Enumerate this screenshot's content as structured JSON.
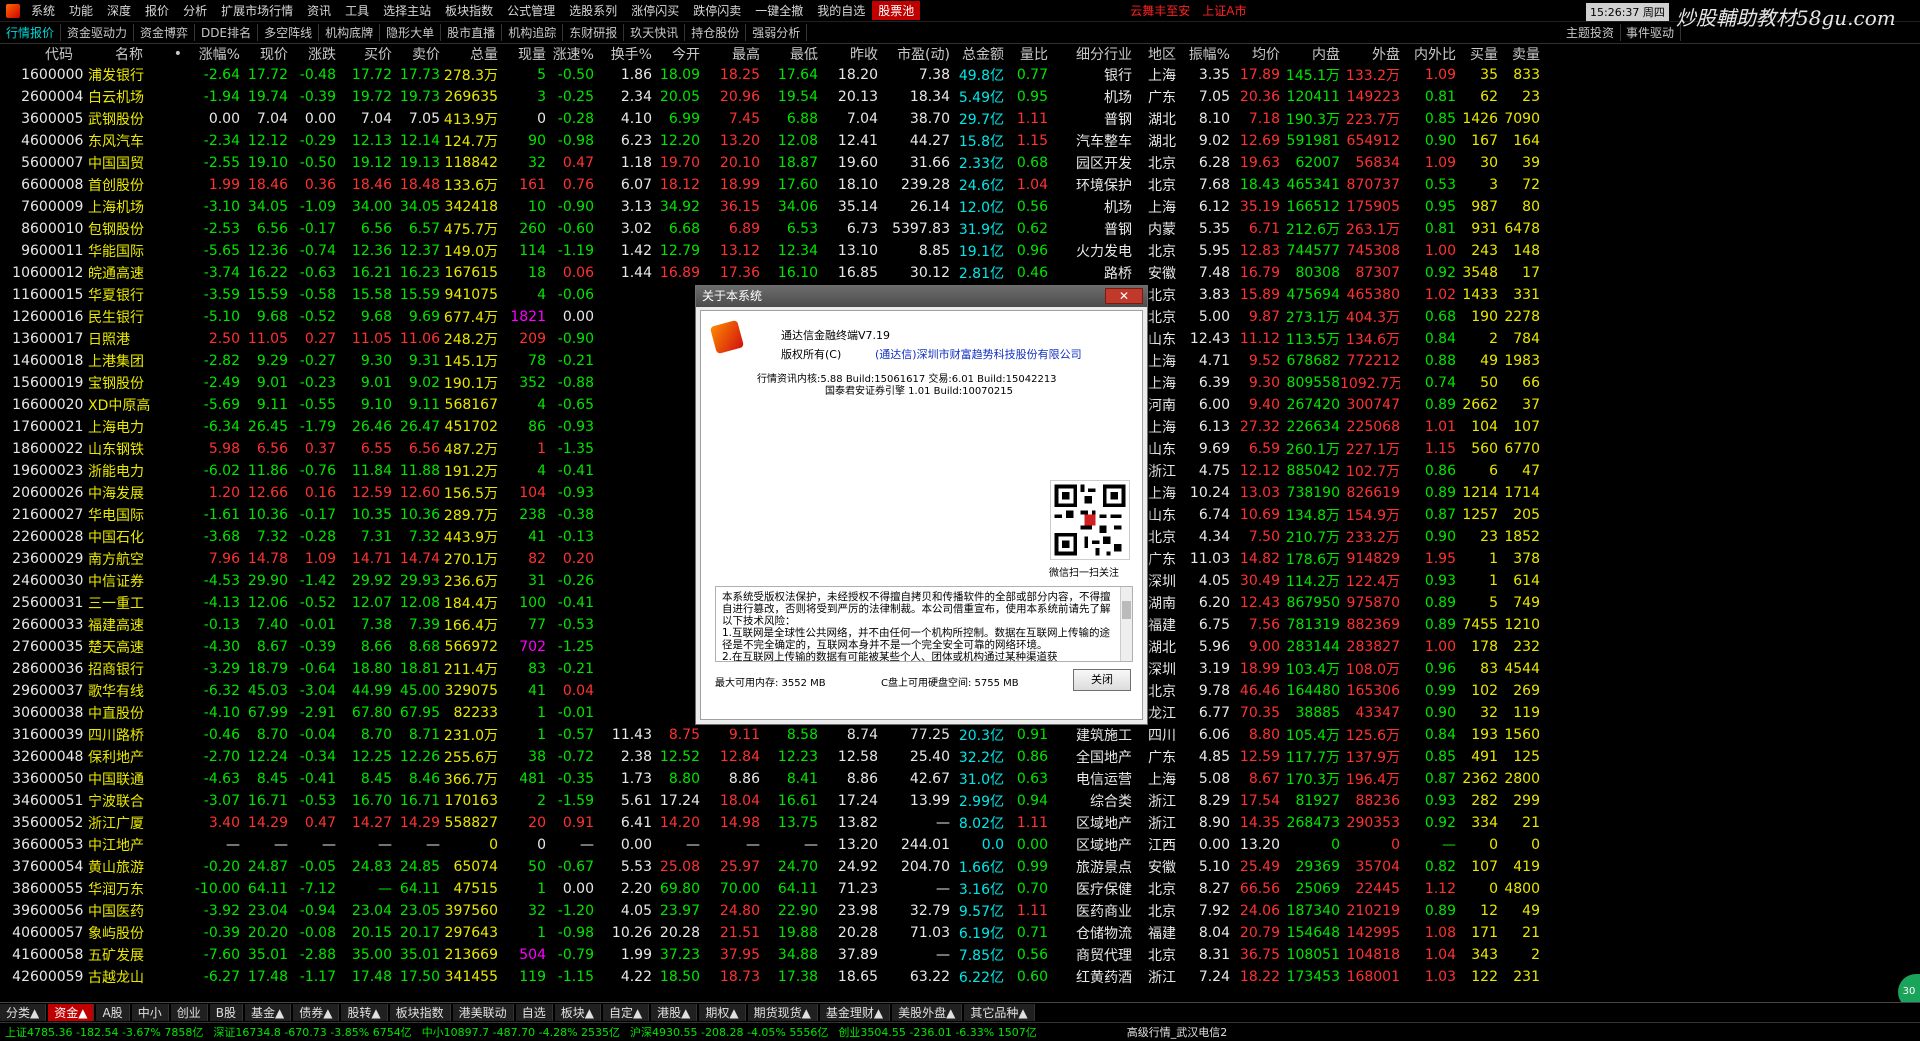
{
  "menubar": {
    "items": [
      "系统",
      "功能",
      "深度",
      "报价",
      "分析",
      "扩展市场行情",
      "资讯",
      "工具",
      "选择主站",
      "板块指数",
      "公式管理",
      "选股系列",
      "涨停闪买",
      "跌停闪卖",
      "一键全撤",
      "我的自选"
    ],
    "highlight": "股票池",
    "notice1": "云舞丰至安",
    "notice2": "上证A市",
    "clock": "15:26:37 周四",
    "brand": "炒股輔助教材58gu.com"
  },
  "toolbar": {
    "items": [
      "行情报价",
      "资金驱动力",
      "资金博弈",
      "DDE排名",
      "多空阵线",
      "机构底牌",
      "隐形大单",
      "股市直播",
      "机构追踪",
      "东财研报",
      "玖天快讯",
      "持仓股份",
      "强弱分析"
    ],
    "right": [
      "主题投资",
      "事件驱动"
    ]
  },
  "columns": [
    "",
    "代码",
    "名称",
    "•",
    "涨幅%",
    "现价",
    "涨跌",
    "买价",
    "卖价",
    "总量",
    "现量",
    "涨速%",
    "换手%",
    "今开",
    "最高",
    "最低",
    "昨收",
    "市盈(动)",
    "总金额",
    "量比",
    "细分行业",
    "地区",
    "振幅%",
    "均价",
    "内盘",
    "外盘",
    "内外比",
    "买量",
    "卖量",
    ""
  ],
  "rows": [
    [
      "1",
      "600000",
      "浦发银行",
      "-2.64",
      "17.72",
      "-0.48",
      "17.72",
      "17.73",
      "278.3万",
      "5",
      "-0.50",
      "1.86",
      "18.09",
      "18.25",
      "17.64",
      "18.20",
      "7.38",
      "49.8亿",
      "0.77",
      "银行",
      "上海",
      "3.35",
      "17.89",
      "145.1万",
      "133.2万",
      "1.09",
      "35",
      "833"
    ],
    [
      "2",
      "600004",
      "白云机场",
      "-1.94",
      "19.74",
      "-0.39",
      "19.72",
      "19.73",
      "269635",
      "3",
      "-0.25",
      "2.34",
      "20.05",
      "20.96",
      "19.54",
      "20.13",
      "18.34",
      "5.49亿",
      "0.95",
      "机场",
      "广东",
      "7.05",
      "20.36",
      "120411",
      "149223",
      "0.81",
      "62",
      "23"
    ],
    [
      "3",
      "600005",
      "武钢股份",
      "0.00",
      "7.04",
      "0.00",
      "7.04",
      "7.05",
      "413.9万",
      "0",
      "-0.28",
      "4.10",
      "6.99",
      "7.45",
      "6.88",
      "7.04",
      "38.70",
      "29.7亿",
      "1.11",
      "普钢",
      "湖北",
      "8.10",
      "7.18",
      "190.3万",
      "223.7万",
      "0.85",
      "1426",
      "7090"
    ],
    [
      "4",
      "600006",
      "东风汽车",
      "-2.34",
      "12.12",
      "-0.29",
      "12.13",
      "12.14",
      "124.7万",
      "90",
      "-0.98",
      "6.23",
      "12.20",
      "13.20",
      "12.08",
      "12.41",
      "44.27",
      "15.8亿",
      "1.15",
      "汽车整车",
      "湖北",
      "9.02",
      "12.69",
      "591981",
      "654912",
      "0.90",
      "167",
      "164"
    ],
    [
      "5",
      "600007",
      "中国国贸",
      "-2.55",
      "19.10",
      "-0.50",
      "19.12",
      "19.13",
      "118842",
      "32",
      "0.47",
      "1.18",
      "19.70",
      "20.10",
      "18.87",
      "19.60",
      "31.66",
      "2.33亿",
      "0.68",
      "园区开发",
      "北京",
      "6.28",
      "19.63",
      "62007",
      "56834",
      "1.09",
      "30",
      "39"
    ],
    [
      "6",
      "600008",
      "首创股份",
      "1.99",
      "18.46",
      "0.36",
      "18.46",
      "18.48",
      "133.6万",
      "161",
      "0.76",
      "6.07",
      "18.12",
      "18.99",
      "17.60",
      "18.10",
      "239.28",
      "24.6亿",
      "1.04",
      "环境保护",
      "北京",
      "7.68",
      "18.43",
      "465341",
      "870737",
      "0.53",
      "3",
      "72"
    ],
    [
      "7",
      "600009",
      "上海机场",
      "-3.10",
      "34.05",
      "-1.09",
      "34.00",
      "34.05",
      "342418",
      "10",
      "-0.90",
      "3.13",
      "34.92",
      "36.15",
      "34.06",
      "35.14",
      "26.14",
      "12.0亿",
      "0.56",
      "机场",
      "上海",
      "6.12",
      "35.19",
      "166512",
      "175905",
      "0.95",
      "987",
      "80"
    ],
    [
      "8",
      "600010",
      "包钢股份",
      "-2.53",
      "6.56",
      "-0.17",
      "6.56",
      "6.57",
      "475.7万",
      "260",
      "-0.60",
      "3.02",
      "6.68",
      "6.89",
      "6.53",
      "6.73",
      "5397.83",
      "31.9亿",
      "0.62",
      "普钢",
      "内蒙",
      "5.35",
      "6.71",
      "212.6万",
      "263.1万",
      "0.81",
      "931",
      "6478"
    ],
    [
      "9",
      "600011",
      "华能国际",
      "-5.65",
      "12.36",
      "-0.74",
      "12.36",
      "12.37",
      "149.0万",
      "114",
      "-1.19",
      "1.42",
      "12.79",
      "13.12",
      "12.34",
      "13.10",
      "8.85",
      "19.1亿",
      "0.96",
      "火力发电",
      "北京",
      "5.95",
      "12.83",
      "744577",
      "745308",
      "1.00",
      "243",
      "148"
    ],
    [
      "10",
      "600012",
      "皖通高速",
      "-3.74",
      "16.22",
      "-0.63",
      "16.21",
      "16.23",
      "167615",
      "18",
      "0.06",
      "1.44",
      "16.89",
      "17.36",
      "16.10",
      "16.85",
      "30.12",
      "2.81亿",
      "0.46",
      "路桥",
      "安徽",
      "7.48",
      "16.79",
      "80308",
      "87307",
      "0.92",
      "3548",
      "17"
    ],
    [
      "11",
      "600015",
      "华夏银行",
      "-3.59",
      "15.59",
      "-0.58",
      "15.58",
      "15.59",
      "941075",
      "4",
      "-0.06",
      "",
      "",
      "",
      "",
      "",
      "",
      "",
      "0.78",
      "银行",
      "北京",
      "3.83",
      "15.89",
      "475694",
      "465380",
      "1.02",
      "1433",
      "331"
    ],
    [
      "12",
      "600016",
      "民生银行",
      "-5.10",
      "9.68",
      "-0.52",
      "9.68",
      "9.69",
      "677.4万",
      "1821",
      "0.00",
      "",
      "",
      "",
      "",
      "",
      "",
      "",
      "1.09",
      "银行",
      "北京",
      "5.00",
      "9.87",
      "273.1万",
      "404.3万",
      "0.68",
      "190",
      "2278"
    ],
    [
      "13",
      "600017",
      "日照港",
      "2.50",
      "11.05",
      "0.27",
      "11.05",
      "11.06",
      "248.2万",
      "209",
      "-0.90",
      "",
      "",
      "",
      "",
      "",
      "",
      "",
      "1.02",
      "港口",
      "山东",
      "12.43",
      "11.12",
      "113.5万",
      "134.6万",
      "0.84",
      "2",
      "784"
    ],
    [
      "14",
      "600018",
      "上港集团",
      "-2.82",
      "9.29",
      "-0.27",
      "9.30",
      "9.31",
      "145.1万",
      "78",
      "-0.21",
      "",
      "",
      "",
      "",
      "",
      "",
      "",
      "0.48",
      "港口",
      "上海",
      "4.71",
      "9.52",
      "678682",
      "772212",
      "0.88",
      "49",
      "1983"
    ],
    [
      "15",
      "600019",
      "宝钢股份",
      "-2.49",
      "9.01",
      "-0.23",
      "9.01",
      "9.02",
      "190.1万",
      "352",
      "-0.88",
      "",
      "",
      "",
      "",
      "",
      "",
      "",
      "0.83",
      "普钢",
      "上海",
      "6.39",
      "9.30",
      "809558",
      "1092.7万",
      "0.74",
      "50",
      "66"
    ],
    [
      "16",
      "600020",
      "XD中原高",
      "-5.69",
      "9.11",
      "-0.55",
      "9.10",
      "9.11",
      "568167",
      "4",
      "-0.65",
      "",
      "",
      "",
      "",
      "",
      "",
      "",
      "0.60",
      "路桥",
      "河南",
      "6.00",
      "9.40",
      "267420",
      "300747",
      "0.89",
      "2662",
      "37"
    ],
    [
      "17",
      "600021",
      "上海电力",
      "-6.34",
      "26.45",
      "-1.79",
      "26.46",
      "26.47",
      "451702",
      "86",
      "-0.93",
      "",
      "",
      "",
      "",
      "",
      "",
      "",
      "0.67",
      "火力发电",
      "上海",
      "6.13",
      "27.32",
      "226634",
      "225068",
      "1.01",
      "104",
      "107"
    ],
    [
      "18",
      "600022",
      "山东钢铁",
      "5.98",
      "6.56",
      "0.37",
      "6.55",
      "6.56",
      "487.2万",
      "1",
      "-1.35",
      "",
      "",
      "",
      "",
      "",
      "",
      "",
      "1.75",
      "普钢",
      "山东",
      "9.69",
      "6.59",
      "260.1万",
      "227.1万",
      "1.15",
      "560",
      "6770"
    ],
    [
      "19",
      "600023",
      "浙能电力",
      "-6.02",
      "11.86",
      "-0.76",
      "11.84",
      "11.88",
      "191.2万",
      "4",
      "-0.41",
      "",
      "",
      "",
      "",
      "",
      "",
      "",
      "0.77",
      "火力发电",
      "浙江",
      "4.75",
      "12.12",
      "885042",
      "102.7万",
      "0.86",
      "6",
      "47"
    ],
    [
      "20",
      "600026",
      "中海发展",
      "1.20",
      "12.66",
      "0.16",
      "12.59",
      "12.60",
      "156.5万",
      "104",
      "-0.93",
      "",
      "",
      "",
      "",
      "",
      "",
      "",
      "1.29",
      "水运",
      "上海",
      "10.24",
      "13.03",
      "738190",
      "826619",
      "0.89",
      "1214",
      "1714"
    ],
    [
      "21",
      "600027",
      "华电国际",
      "-1.61",
      "10.36",
      "-0.17",
      "10.35",
      "10.36",
      "289.7万",
      "238",
      "-0.38",
      "",
      "",
      "",
      "",
      "",
      "",
      "",
      "1.50",
      "火力发电",
      "山东",
      "6.74",
      "10.69",
      "134.8万",
      "154.9万",
      "0.87",
      "1257",
      "205"
    ],
    [
      "22",
      "600028",
      "中国石化",
      "-3.68",
      "7.32",
      "-0.28",
      "7.31",
      "7.32",
      "443.9万",
      "41",
      "-0.13",
      "",
      "",
      "",
      "",
      "",
      "",
      "",
      "0.80",
      "石油加工",
      "北京",
      "4.34",
      "7.50",
      "210.7万",
      "233.2万",
      "0.90",
      "23",
      "1852"
    ],
    [
      "23",
      "600029",
      "南方航空",
      "7.96",
      "14.78",
      "1.09",
      "14.71",
      "14.74",
      "270.1万",
      "82",
      "0.20",
      "",
      "",
      "",
      "",
      "",
      "",
      "",
      "1.04",
      "空运",
      "广东",
      "11.03",
      "14.82",
      "178.6万",
      "914829",
      "1.95",
      "1",
      "378"
    ],
    [
      "24",
      "600030",
      "中信证券",
      "-4.53",
      "29.90",
      "-1.42",
      "29.92",
      "29.93",
      "236.6万",
      "31",
      "-0.26",
      "",
      "",
      "",
      "",
      "",
      "",
      "",
      "0.86",
      "证券",
      "深圳",
      "4.05",
      "30.49",
      "114.2万",
      "122.4万",
      "0.93",
      "1",
      "614"
    ],
    [
      "25",
      "600031",
      "三一重工",
      "-4.13",
      "12.06",
      "-0.52",
      "12.07",
      "12.08",
      "184.4万",
      "100",
      "-0.41",
      "",
      "",
      "",
      "",
      "",
      "",
      "",
      "0.46",
      "工程机械",
      "湖南",
      "6.20",
      "12.43",
      "867950",
      "975870",
      "0.89",
      "5",
      "749"
    ],
    [
      "26",
      "600033",
      "福建高速",
      "-0.13",
      "7.40",
      "-0.01",
      "7.38",
      "7.39",
      "166.4万",
      "77",
      "-0.53",
      "",
      "",
      "",
      "",
      "",
      "",
      "",
      "1.10",
      "路桥",
      "福建",
      "6.75",
      "7.56",
      "781319",
      "882369",
      "0.89",
      "7455",
      "1210"
    ],
    [
      "27",
      "600035",
      "楚天高速",
      "-4.30",
      "8.67",
      "-0.39",
      "8.66",
      "8.68",
      "566972",
      "702",
      "-1.25",
      "",
      "",
      "",
      "",
      "",
      "",
      "",
      "0.61",
      "路桥",
      "湖北",
      "5.96",
      "9.00",
      "283144",
      "283827",
      "1.00",
      "178",
      "232"
    ],
    [
      "28",
      "600036",
      "招商银行",
      "-3.29",
      "18.79",
      "-0.64",
      "18.80",
      "18.81",
      "211.4万",
      "83",
      "-0.21",
      "",
      "",
      "",
      "",
      "",
      "",
      "",
      "0.82",
      "银行",
      "深圳",
      "3.19",
      "18.99",
      "103.4万",
      "108.0万",
      "0.96",
      "83",
      "4544"
    ],
    [
      "29",
      "600037",
      "歌华有线",
      "-6.32",
      "45.03",
      "-3.04",
      "44.99",
      "45.00",
      "329075",
      "41",
      "0.04",
      "",
      "",
      "",
      "",
      "",
      "",
      "",
      "1.03",
      "影视音像",
      "北京",
      "9.78",
      "46.46",
      "164480",
      "165306",
      "0.99",
      "102",
      "269"
    ],
    [
      "30",
      "600038",
      "中直股份",
      "-4.10",
      "67.99",
      "-2.91",
      "67.80",
      "67.95",
      "82233",
      "1",
      "-0.01",
      "",
      "",
      "",
      "",
      "",
      "",
      "",
      "0.67",
      "航空",
      "黑龙江",
      "6.77",
      "70.35",
      "38885",
      "43347",
      "0.90",
      "32",
      "119"
    ],
    [
      "31",
      "600039",
      "四川路桥",
      "-0.46",
      "8.70",
      "-0.04",
      "8.70",
      "8.71",
      "231.0万",
      "1",
      "-0.57",
      "11.43",
      "8.75",
      "9.11",
      "8.58",
      "8.74",
      "77.25",
      "20.3亿",
      "0.91",
      "建筑施工",
      "四川",
      "6.06",
      "8.80",
      "105.4万",
      "125.6万",
      "0.84",
      "193",
      "1560"
    ],
    [
      "32",
      "600048",
      "保利地产",
      "-2.70",
      "12.24",
      "-0.34",
      "12.25",
      "12.26",
      "255.6万",
      "38",
      "-0.72",
      "2.38",
      "12.52",
      "12.84",
      "12.23",
      "12.58",
      "25.40",
      "32.2亿",
      "0.86",
      "全国地产",
      "广东",
      "4.85",
      "12.59",
      "117.7万",
      "137.9万",
      "0.85",
      "491",
      "125"
    ],
    [
      "33",
      "600050",
      "中国联通",
      "-4.63",
      "8.45",
      "-0.41",
      "8.45",
      "8.46",
      "366.7万",
      "481",
      "-0.35",
      "1.73",
      "8.80",
      "8.86",
      "8.41",
      "8.86",
      "42.67",
      "31.0亿",
      "0.63",
      "电信运营",
      "上海",
      "5.08",
      "8.67",
      "170.3万",
      "196.4万",
      "0.87",
      "2362",
      "2800"
    ],
    [
      "34",
      "600051",
      "宁波联合",
      "-3.07",
      "16.71",
      "-0.53",
      "16.70",
      "16.71",
      "170163",
      "2",
      "-1.59",
      "5.61",
      "17.24",
      "18.04",
      "16.61",
      "17.24",
      "13.99",
      "2.99亿",
      "0.94",
      "综合类",
      "浙江",
      "8.29",
      "17.54",
      "81927",
      "88236",
      "0.93",
      "282",
      "299"
    ],
    [
      "35",
      "600052",
      "浙江广厦",
      "3.40",
      "14.29",
      "0.47",
      "14.27",
      "14.29",
      "558827",
      "20",
      "0.91",
      "6.41",
      "14.20",
      "14.98",
      "13.75",
      "13.82",
      "—",
      "8.02亿",
      "1.11",
      "区域地产",
      "浙江",
      "8.90",
      "14.35",
      "268473",
      "290353",
      "0.92",
      "334",
      "21"
    ],
    [
      "36",
      "600053",
      "中江地产",
      "—",
      "—",
      "—",
      "—",
      "—",
      "0",
      "0",
      "—",
      "0.00",
      "—",
      "—",
      "—",
      "13.20",
      "244.01",
      "0.0",
      "0.00",
      "区域地产",
      "江西",
      "0.00",
      "13.20",
      "0",
      "0",
      "—",
      "0",
      "0"
    ],
    [
      "37",
      "600054",
      "黄山旅游",
      "-0.20",
      "24.87",
      "-0.05",
      "24.83",
      "24.85",
      "65074",
      "50",
      "-0.67",
      "5.53",
      "25.08",
      "25.97",
      "24.70",
      "24.92",
      "204.70",
      "1.66亿",
      "0.99",
      "旅游景点",
      "安徽",
      "5.10",
      "25.49",
      "29369",
      "35704",
      "0.82",
      "107",
      "419"
    ],
    [
      "38",
      "600055",
      "华润万东",
      "-10.00",
      "64.11",
      "-7.12",
      "—",
      "64.11",
      "47515",
      "1",
      "0.00",
      "2.20",
      "69.80",
      "70.00",
      "64.11",
      "71.23",
      "—",
      "3.16亿",
      "0.70",
      "医疗保健",
      "北京",
      "8.27",
      "66.56",
      "25069",
      "22445",
      "1.12",
      "0",
      "4800"
    ],
    [
      "39",
      "600056",
      "中国医药",
      "-3.92",
      "23.04",
      "-0.94",
      "23.04",
      "23.05",
      "397560",
      "32",
      "-1.20",
      "4.05",
      "23.97",
      "24.80",
      "22.90",
      "23.98",
      "32.79",
      "9.57亿",
      "1.11",
      "医药商业",
      "北京",
      "7.92",
      "24.06",
      "187340",
      "210219",
      "0.89",
      "12",
      "49"
    ],
    [
      "40",
      "600057",
      "象屿股份",
      "-0.39",
      "20.20",
      "-0.08",
      "20.15",
      "20.17",
      "297643",
      "1",
      "-0.98",
      "10.26",
      "20.28",
      "21.51",
      "19.88",
      "20.28",
      "71.03",
      "6.19亿",
      "0.71",
      "仓储物流",
      "福建",
      "8.04",
      "20.79",
      "154648",
      "142995",
      "1.08",
      "171",
      "21"
    ],
    [
      "41",
      "600058",
      "五矿发展",
      "-7.60",
      "35.01",
      "-2.88",
      "35.00",
      "35.01",
      "213669",
      "504",
      "-0.79",
      "1.99",
      "37.23",
      "37.95",
      "34.88",
      "37.89",
      "—",
      "7.85亿",
      "0.56",
      "商贸代理",
      "北京",
      "8.31",
      "36.75",
      "108051",
      "104818",
      "1.04",
      "343",
      "2"
    ],
    [
      "42",
      "600059",
      "古越龙山",
      "-6.27",
      "17.48",
      "-1.17",
      "17.48",
      "17.50",
      "341455",
      "119",
      "-1.15",
      "4.22",
      "18.50",
      "18.73",
      "17.38",
      "18.65",
      "63.22",
      "6.22亿",
      "0.60",
      "红黄药酒",
      "浙江",
      "7.24",
      "18.22",
      "173453",
      "168001",
      "1.03",
      "122",
      "231"
    ]
  ],
  "bottom_tabs": {
    "items": [
      "分类▲",
      "资金▲",
      "A股",
      "中小",
      "创业",
      "B股",
      "基金▲",
      "债券▲",
      "股转▲",
      "板块指数",
      "港美联动",
      "自选",
      "板块▲",
      "自定▲",
      "港股▲",
      "期权▲",
      "期货现货▲",
      "基金理财▲",
      "美股外盘▲",
      "其它品种▲"
    ],
    "active_index": 1
  },
  "statusbar": {
    "segments": [
      {
        "text": "上证4785.36 -182.54 -3.67% 7858亿",
        "color": "#00e600"
      },
      {
        "text": "深证16734.8 -670.73 -3.85% 6754亿",
        "color": "#00e600"
      },
      {
        "text": "中小10897.7 -487.70 -4.28% 2535亿",
        "color": "#00e600"
      },
      {
        "text": "沪深4930.55 -208.28 -4.05% 5556亿",
        "color": "#00e600"
      },
      {
        "text": "创业3504.55 -236.01 -6.33% 1507亿",
        "color": "#00e600"
      },
      {
        "text": "高级行情_武汉电信2",
        "color": "#e0e0e0"
      }
    ]
  },
  "dialog": {
    "title": "关于本系统",
    "close_x": "✕",
    "app_name": "通达信金融终端V7.19",
    "copyright_label": "版权所有(C)",
    "company": "(通达信)深圳市财富趋势科技股份有限公司",
    "kernel": "行情资讯内核:5.88 Build:15061617  交易:6.01 Build:15042213",
    "engine": "国泰君安证券引擎 1.01 Build:10070215",
    "qr_caption": "微信扫一扫关注",
    "legal_text": "本系统受版权法保护，未经授权不得擅自拷贝和传播软件的全部或部分内容，不得擅自进行篡改，否则将受到严厉的法律制裁。本公司借重宣布，使用本系统前请先了解以下技术风险：\n1.互联网是全球性公共网络，并不由任何一个机构所控制。数据在互联网上传输的途径是不完全确定的，互联网本身并不是一个完全安全可靠的网络环境。\n2.在互联网上传输的数据有可能被某些个人、团体或机构通过某种渠道获",
    "memory": "最大可用内存:  3552 MB",
    "disk": "C盘上可用硬盘空间:  5755 MB",
    "ok_label": "关闭"
  },
  "side_button": "30"
}
